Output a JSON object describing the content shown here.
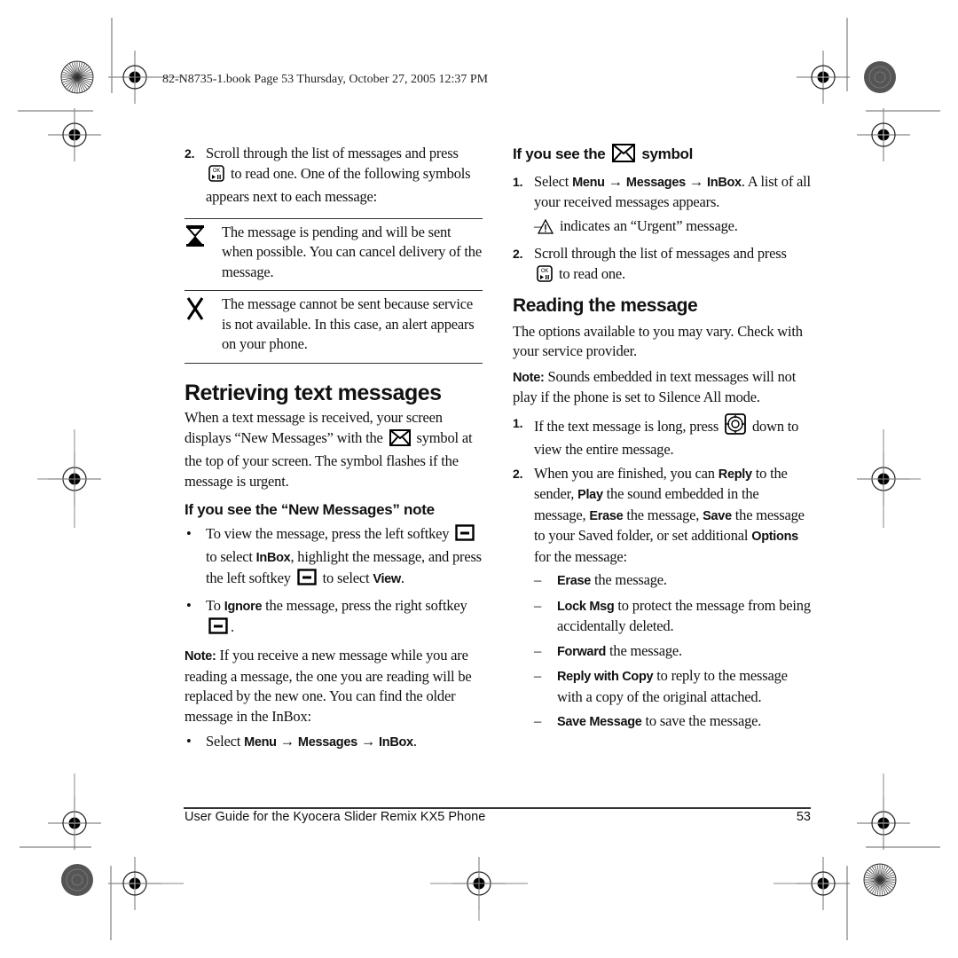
{
  "slug": "82-N8735-1.book  Page 53  Thursday, October 27, 2005  12:37 PM",
  "left_column": {
    "step2": {
      "number": "2.",
      "text_a": "Scroll through the list of messages and press",
      "text_b": "to read one.  One of the following symbols appears next to each message:"
    },
    "symbols": [
      {
        "icon": "hourglass-icon",
        "text": "The message is pending and will be sent when possible. You can cancel delivery of the message."
      },
      {
        "icon": "x-mark-icon",
        "text": "The message cannot be sent because service is not available. In this case, an alert appears on your phone."
      }
    ],
    "heading": "Retrieving text messages",
    "intro_a": "When a text message is received, your screen displays “New Messages” with the",
    "intro_b": "symbol at the top of your screen. The symbol flashes if the message is urgent.",
    "subheading": "If you see the “New Messages” note",
    "bullet1": {
      "a": "To view the message, press the left softkey",
      "b": "to select",
      "b_bold": "InBox",
      "c": ", highlight the message, and press the left softkey",
      "d": "to select",
      "d_bold": "View",
      "e": "."
    },
    "bullet2": {
      "a": "To",
      "a_bold": "Ignore",
      "b": "the message, press the right softkey",
      "c": "."
    },
    "note": {
      "label": "Note:",
      "text": "If you receive a new message while you are reading a message, the one you are reading will be replaced by the new one. You can find the older message in the InBox:"
    },
    "bullet3": {
      "a": "Select",
      "menu": "Menu",
      "arrow": "→",
      "messages": "Messages",
      "inbox": "InBox",
      "end": "."
    },
    "bullet_char": "•"
  },
  "right_column": {
    "subheading_a": "If you see the",
    "subheading_b": "symbol",
    "step1": {
      "number": "1.",
      "a": "Select",
      "menu": "Menu",
      "arrow": "→",
      "messages": "Messages",
      "inbox": "InBox",
      "b": ". A list of all your received messages appears."
    },
    "urgent": {
      "dash": "–",
      "text": "indicates an “Urgent” message."
    },
    "step2": {
      "number": "2.",
      "a": "Scroll through the list of messages and press",
      "b": "to read one."
    },
    "heading": "Reading the message",
    "intro": "The options available to you may vary. Check with your service provider.",
    "note": {
      "label": "Note:",
      "text": "Sounds embedded in text messages will not play if the phone is set to Silence All mode."
    },
    "read1": {
      "number": "1.",
      "a": "If the text message is long, press",
      "b": "down to view the entire message."
    },
    "read2": {
      "number": "2.",
      "a": "When you are finished, you can",
      "reply": "Reply",
      "b": "to the sender,",
      "play": "Play",
      "c": "the sound embedded in the message,",
      "erase": "Erase",
      "d": "the message,",
      "save": "Save",
      "e": "the message to your Saved folder, or set additional",
      "options": "Options",
      "f": "for the message:"
    },
    "options": [
      {
        "label": "Erase",
        "text": "the message."
      },
      {
        "label": "Lock Msg",
        "text": "to protect the message from being accidentally deleted."
      },
      {
        "label": "Forward",
        "text": "the message."
      },
      {
        "label": "Reply with Copy",
        "text": "to reply to the message with a copy of the original attached."
      },
      {
        "label": "Save Message",
        "text": "to save the message."
      }
    ],
    "dash_char": "–"
  },
  "footer": {
    "title": "User Guide for the Kyocera Slider Remix KX5 Phone",
    "page": "53"
  }
}
